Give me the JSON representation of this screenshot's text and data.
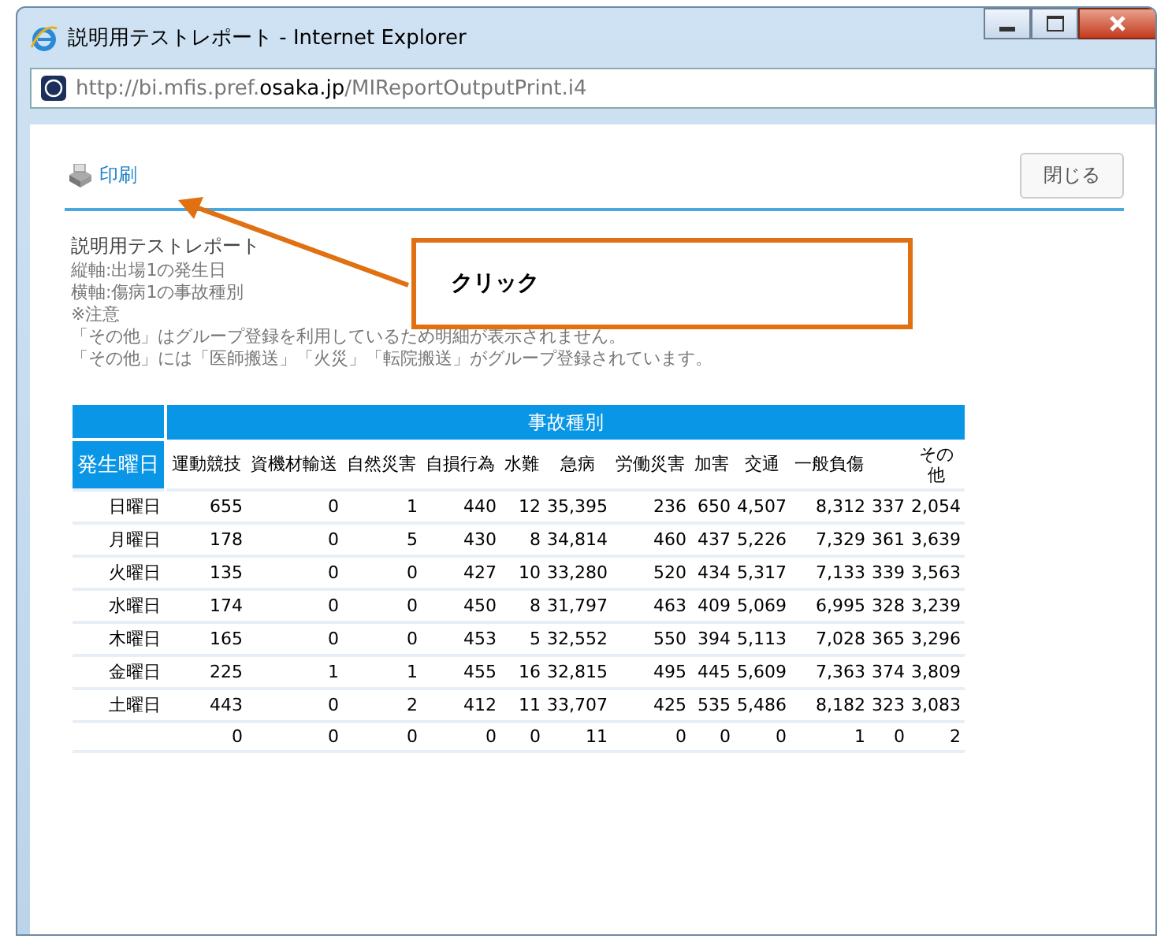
{
  "window": {
    "title": "説明用テストレポート - Internet Explorer",
    "url_prefix": "http://bi.mfis.pref.",
    "url_domain": "osaka.jp",
    "url_path": "/MIReportOutputPrint.i4"
  },
  "toolbar": {
    "print": "印刷",
    "close": "閉じる"
  },
  "report": {
    "title": "説明用テストレポート",
    "lines": [
      "縦軸:出場1の発生日",
      "横軸:傷病1の事故種別",
      "※注意",
      "「その他」はグループ登録を利用しているため明細が表示されません。",
      "「その他」には「医師搬送」「火災」「転院搬送」がグループ登録されています。"
    ]
  },
  "callout": {
    "text": "クリック"
  },
  "table": {
    "group_header": "事故種別",
    "row_header": "発生曜日",
    "columns": [
      {
        "label": "運動競技"
      },
      {
        "label": "資機材輸送"
      },
      {
        "label": "自然災害"
      },
      {
        "label": "自損行為"
      },
      {
        "label": "水難"
      },
      {
        "label": "急病"
      },
      {
        "label": "労働災害"
      },
      {
        "label": "加害"
      },
      {
        "label": "交通"
      },
      {
        "label": "一般負傷"
      },
      {},
      {
        "label": "その他"
      }
    ],
    "rows": [
      {
        "label": "日曜日",
        "values": [
          "655",
          "0",
          "1",
          "440",
          "12",
          "35,395",
          "236",
          "650",
          "4,507",
          "8,312",
          "337",
          "2,054"
        ]
      },
      {
        "label": "月曜日",
        "values": [
          "178",
          "0",
          "5",
          "430",
          "8",
          "34,814",
          "460",
          "437",
          "5,226",
          "7,329",
          "361",
          "3,639"
        ]
      },
      {
        "label": "火曜日",
        "values": [
          "135",
          "0",
          "0",
          "427",
          "10",
          "33,280",
          "520",
          "434",
          "5,317",
          "7,133",
          "339",
          "3,563"
        ]
      },
      {
        "label": "水曜日",
        "values": [
          "174",
          "0",
          "0",
          "450",
          "8",
          "31,797",
          "463",
          "409",
          "5,069",
          "6,995",
          "328",
          "3,239"
        ]
      },
      {
        "label": "木曜日",
        "values": [
          "165",
          "0",
          "0",
          "453",
          "5",
          "32,552",
          "550",
          "394",
          "5,113",
          "7,028",
          "365",
          "3,296"
        ]
      },
      {
        "label": "金曜日",
        "values": [
          "225",
          "1",
          "1",
          "455",
          "16",
          "32,815",
          "495",
          "445",
          "5,609",
          "7,363",
          "374",
          "3,809"
        ]
      },
      {
        "label": "土曜日",
        "values": [
          "443",
          "0",
          "2",
          "412",
          "11",
          "33,707",
          "425",
          "535",
          "5,486",
          "8,182",
          "323",
          "3,083"
        ]
      },
      {
        "values": [
          "0",
          "0",
          "0",
          "0",
          "0",
          "11",
          "0",
          "0",
          "0",
          "1",
          "0",
          "2"
        ]
      }
    ]
  }
}
